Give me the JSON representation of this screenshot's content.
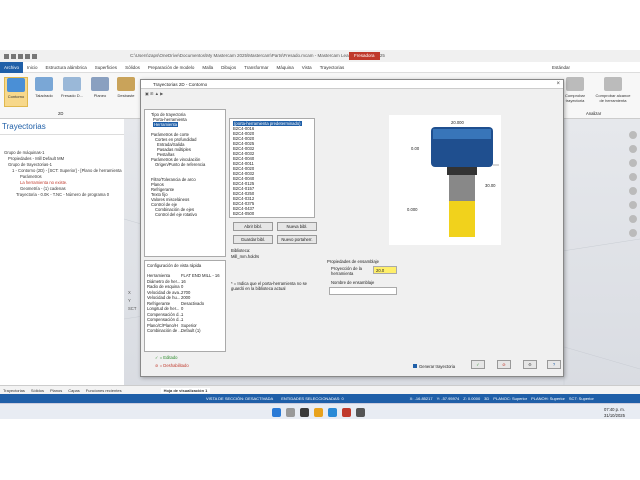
{
  "window": {
    "title": "C:\\Users\\zaps\\OneDrive\\Documentos\\My Mastercam 2025\\Mastercam\\Parts\\Fresado.mcam - Mastercam Learning Edition 2025",
    "context_tab": "Fresadora"
  },
  "menubar": [
    "Archivo",
    "Inicio",
    "Estructura alámbrica",
    "Superficies",
    "Sólidos",
    "Preparación de modelo",
    "Malla",
    "Dibujos",
    "Transformar",
    "Máquina",
    "Vista",
    "Trayectorias"
  ],
  "menubar_right": "Estándar",
  "ribbon": {
    "buttons": [
      "Contorno",
      "Taladrado",
      "Fresado D...",
      "Planeo",
      "Desbaste"
    ],
    "group_label": "2D",
    "right_buttons": [
      "Comprobar trayectoria",
      "Comprobar alcance de herramienta"
    ],
    "right_group": "Analizar"
  },
  "manager": {
    "title": "Trayectorias",
    "tree": [
      "Grupo de máquinas-1",
      "Propiedades - Mill Default MM",
      "Grupo de trayectorias-1",
      "1 - Contorno (2D) - [SCT: Superior] - [Plano de herramienta",
      "Parámetros",
      "La herramienta no existe.",
      "Geometría - (1) cadenas",
      "Trayectoria - 0.0K - T.NC - Número de programa 0"
    ]
  },
  "viewport": {
    "side_labels": [
      "X",
      "Y",
      "SCT"
    ]
  },
  "dialog": {
    "title": "Trayectorias 2D - Contorno",
    "nav_tree": [
      "Tipo de trayectoria",
      "Porta-herramienta",
      "Herramienta",
      "Parámetros de corte",
      "Cortes en profundidad",
      "Entrada/Salida",
      "Pasadas múltiples",
      "Pestañas",
      "Parámetros de vinculación",
      "Origen/Punto de referencia",
      "Filtro/Tolerancia de arco",
      "Planos",
      "Refrigerante",
      "Texto fijo",
      "Valores misceláneos",
      "Control de eje",
      "Combinación de ejes",
      "Control del eje rotativo"
    ],
    "holder_list": [
      "(porta-herramienta predeterminado)",
      "B2C4-0016",
      "B2C4-0020",
      "B2C4-0020",
      "B2C4-0025",
      "B2C4-0032",
      "B2C4-0032",
      "B2C4-0040",
      "B2C4-0011",
      "B2C4-0020",
      "B2C4-0032",
      "B2C4-0040",
      "B2C4-0125",
      "B2C4-0157",
      "B2C4-0250",
      "B2C4-0312",
      "B2C4-0375",
      "B2C4-0437",
      "B2C4-0500"
    ],
    "buttons": {
      "open_lib": "Abrir bibl.",
      "new_lib": "Nueva bibl.",
      "save_holder": "Guardar bibl.",
      "new_holder": "Nuevo portaherr."
    },
    "library_label": "Biblioteca:",
    "library_value": "Mill_mm.holdrs",
    "note": "* = Indica que el porta-herramienta no se guardó en la biblioteca actual",
    "assembly": {
      "title": "Propiedades de ensamblaje",
      "projection_label": "Proyección de la herramienta",
      "projection_value": "20.0",
      "name_label": "Nombre de ensamblaje",
      "name_value": ""
    },
    "preview": {
      "dim_top": "20.000",
      "dim_left": "0.00",
      "dim_right": "30.00",
      "dim_bottom": "0.000"
    },
    "quick_view": {
      "title": "Configuración de vista rápida",
      "rows": [
        [
          "Herramienta",
          "FLAT END MILL - 16"
        ],
        [
          "Diámetro de her...",
          "16"
        ],
        [
          "Radio de esquina",
          "0"
        ],
        [
          "Velocidad de ava...",
          "2700"
        ],
        [
          "Velocidad de hu...",
          "2000"
        ],
        [
          "Refrigerante",
          "Desactivado"
        ],
        [
          "Longitud de her...",
          "0"
        ],
        [
          "Compensación d...",
          "1"
        ],
        [
          "Compensación d...",
          "1"
        ],
        [
          "Plano/C/Plano/H",
          "Superior"
        ],
        [
          "Combinación de ...",
          "Default (1)"
        ]
      ]
    },
    "legend": {
      "enabled": "= Editado",
      "disabled": "= Deshabilitado"
    },
    "generate_label": "Generar trayectoria"
  },
  "bottom_tabs": [
    "Trayectorias",
    "Sólidos",
    "Planos",
    "Capas",
    "Funciones recientes",
    "Hoja de visualización 1"
  ],
  "statusbar": {
    "left": "VISTA DE SECCIÓN: DESACTIVADA",
    "selected": "ENTIDADES SELECCIONADAS: 0",
    "x": "X: -16.85217",
    "y": "Y: -57.95974",
    "z": "Z: 0.0000",
    "mode": "3D",
    "plane": "PLANOC: Superior",
    "planoh": "PLANOH: Superior",
    "wcs": "SCT: Superior"
  },
  "taskbar": {
    "time": "07:40 p. m.",
    "date": "31/10/2025"
  },
  "colors": {
    "accent": "#1f5fa8",
    "holder": "#1f4f8f",
    "tool": "#f1d21c",
    "highlight": "#ffef6a"
  }
}
